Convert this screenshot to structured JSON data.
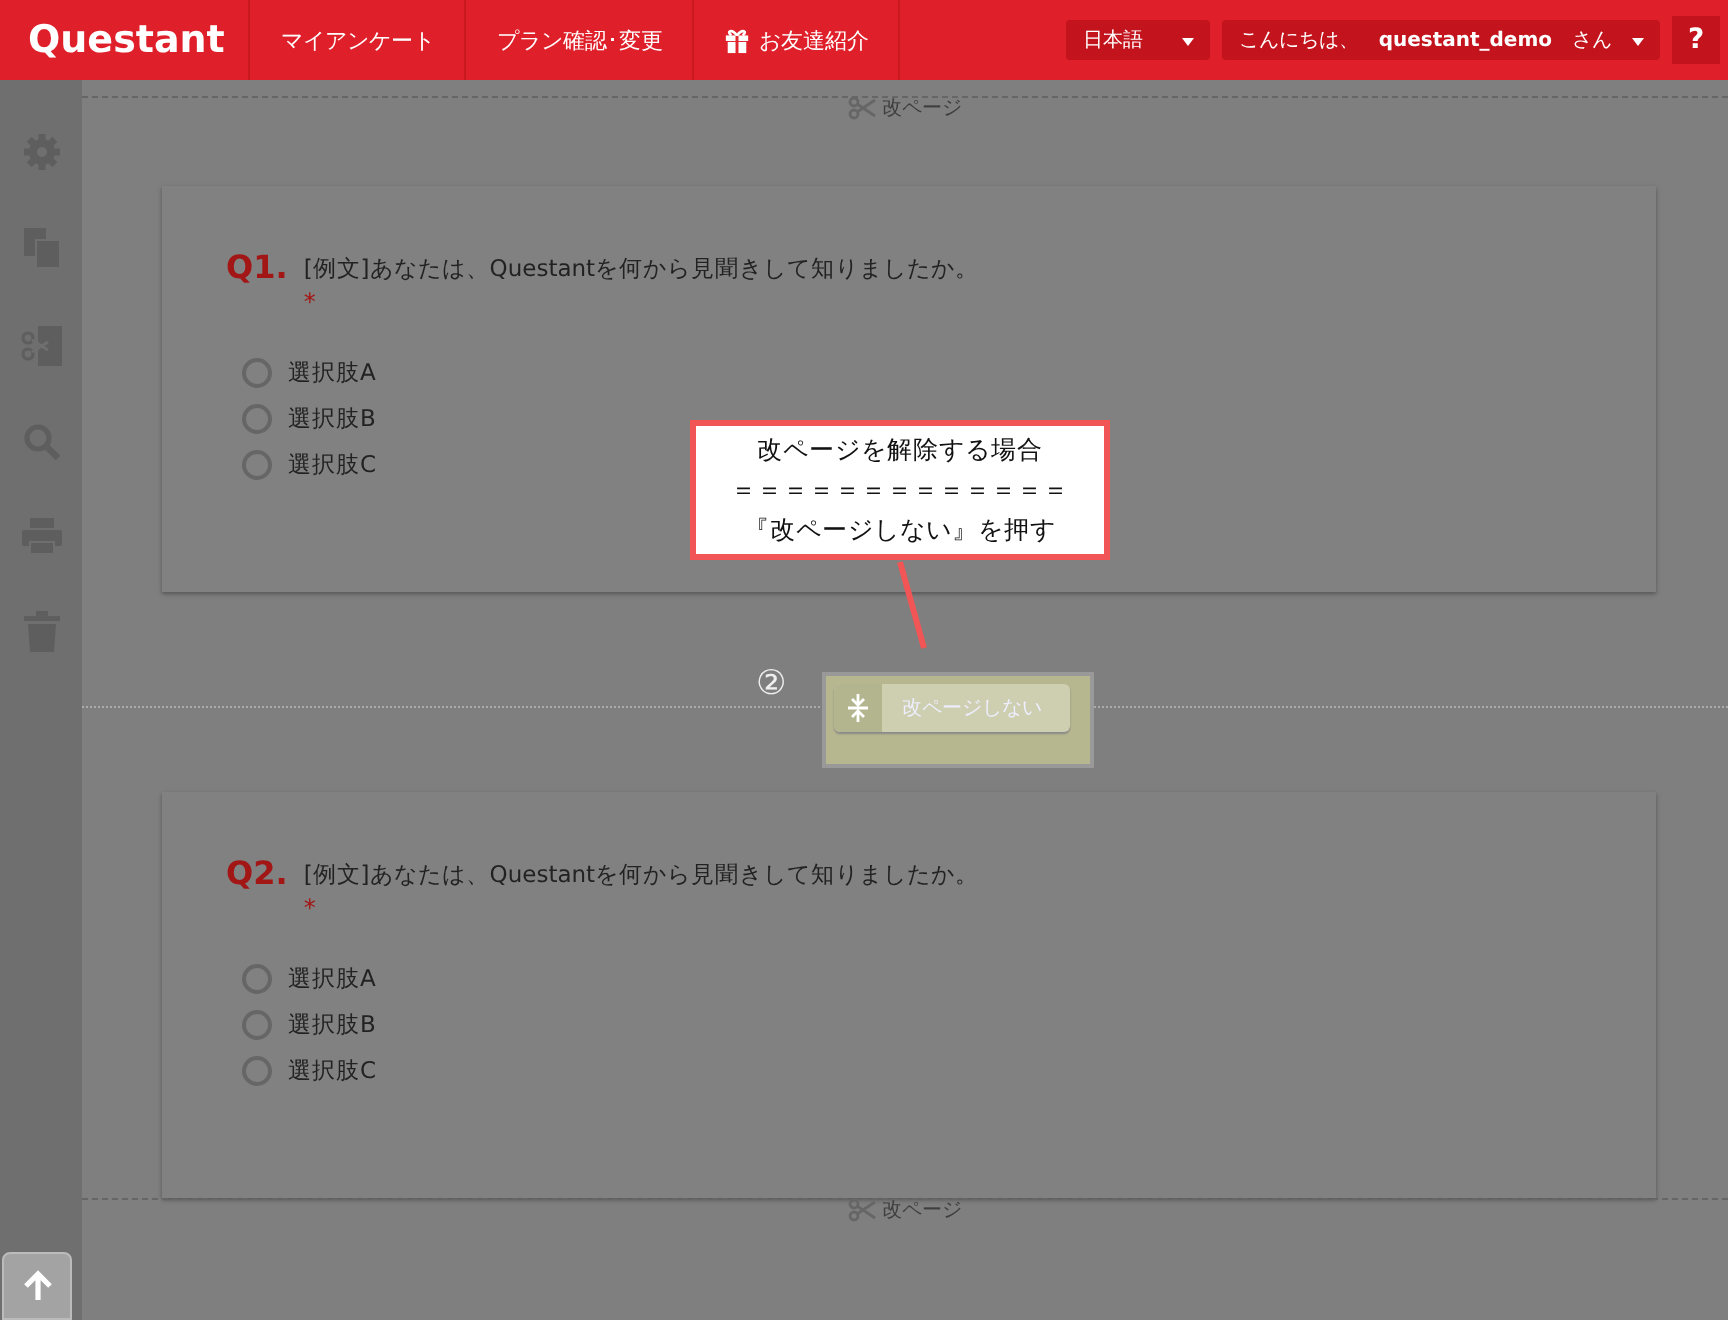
{
  "header": {
    "logo": "Questant",
    "nav": [
      {
        "label": "マイアンケート",
        "has_icon": false
      },
      {
        "label": "プラン確認･変更",
        "has_icon": false
      },
      {
        "label": "お友達紹介",
        "has_icon": true
      }
    ],
    "language": "日本語",
    "greeting": "こんにちは、**questant_demo**さん",
    "help": "?"
  },
  "top_break": {
    "label": "改ページ"
  },
  "questions": [
    {
      "number": "Q1.",
      "text": "[例文]あなたは、Questantを何から見聞きして知りましたか。",
      "required_mark": "*",
      "options": [
        {
          "label": "選択肢A",
          "selected": false
        },
        {
          "label": "選択肢B",
          "selected": false
        },
        {
          "label": "選択肢C",
          "selected": false
        }
      ]
    },
    {
      "number": "Q2.",
      "text": "[例文]あなたは、Questantを何から見聞きして知りましたか。",
      "required_mark": "*",
      "options": [
        {
          "label": "選択肢A",
          "selected": false
        },
        {
          "label": "選択肢B",
          "selected": false
        },
        {
          "label": "選択肢C",
          "selected": false
        }
      ]
    }
  ],
  "middle_break": {
    "step": "②",
    "button": "改ページしない"
  },
  "annotation": {
    "lines": [
      "改ページを解除する場合",
      "＝＝＝＝＝＝＝＝＝＝＝＝＝",
      "『改ページしない』を押す"
    ]
  },
  "bottom_break": {
    "label": "改ページ"
  }
}
